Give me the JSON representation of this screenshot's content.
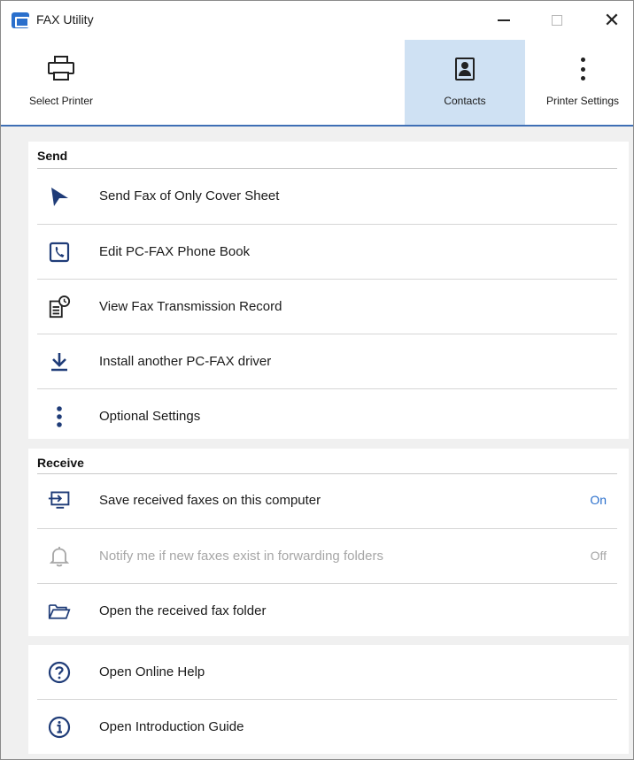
{
  "window": {
    "title": "FAX Utility",
    "accent_color": "#2a6fcc",
    "selected_tab_bg": "#cfe1f3"
  },
  "titlebar": {
    "minimize_icon": "minimize-icon",
    "maximize_icon": "maximize-icon",
    "close_icon": "close-icon",
    "close_glyph": "✕"
  },
  "toolbar": {
    "select_printer": {
      "label": "Select Printer",
      "icon": "printer-icon"
    },
    "contacts": {
      "label": "Contacts",
      "icon": "contact-card-icon",
      "selected": true
    },
    "printer_settings": {
      "label": "Printer Settings",
      "icon": "vertical-dots-icon"
    }
  },
  "send": {
    "heading": "Send",
    "items": [
      {
        "label": "Send Fax of Only Cover Sheet",
        "icon": "send-arrow-icon"
      },
      {
        "label": "Edit PC-FAX Phone Book",
        "icon": "phone-book-icon"
      },
      {
        "label": "View Fax Transmission Record",
        "icon": "document-clock-icon"
      },
      {
        "label": "Install another PC-FAX driver",
        "icon": "download-install-icon"
      },
      {
        "label": "Optional Settings",
        "icon": "vertical-dots-icon"
      }
    ]
  },
  "receive": {
    "heading": "Receive",
    "items": [
      {
        "label": "Save received faxes on this computer",
        "icon": "computer-save-icon",
        "status": "On",
        "enabled": true
      },
      {
        "label": "Notify me if new faxes exist in forwarding folders",
        "icon": "bell-icon",
        "status": "Off",
        "enabled": false
      },
      {
        "label": "Open the received fax folder",
        "icon": "open-folder-icon"
      }
    ]
  },
  "help": {
    "items": [
      {
        "label": "Open Online Help",
        "icon": "question-circle-icon"
      },
      {
        "label": "Open Introduction Guide",
        "icon": "info-circle-icon"
      }
    ]
  }
}
